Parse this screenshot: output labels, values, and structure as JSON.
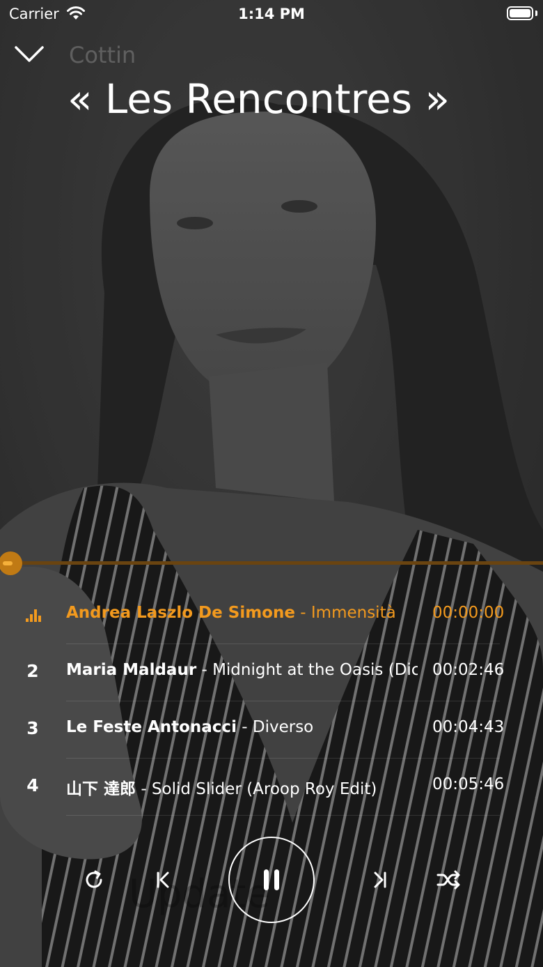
{
  "status_bar": {
    "carrier": "Carrier",
    "time": "1:14 PM"
  },
  "header": {
    "station": "Cottin",
    "show_title": "« Les Rencontres »",
    "close_icon": "chevron-down-icon"
  },
  "player": {
    "progress": 0.0,
    "accent_color": "#f39a1e"
  },
  "tracks": [
    {
      "number": "",
      "playing": true,
      "artist": "Andrea Laszlo De Simone",
      "title": " - Immensità",
      "time": "00:00:00"
    },
    {
      "number": "2",
      "playing": false,
      "artist": "Maria Maldaur",
      "title": " - Midnight at the Oasis (Dice Ed",
      "time": "00:02:46"
    },
    {
      "number": "3",
      "playing": false,
      "artist": "Le Feste Antonacci",
      "title": " - Diverso",
      "time": "00:04:43"
    },
    {
      "number": "4",
      "playing": false,
      "artist": "山下 達郎",
      "title": " - Solid Slider (Aroop Roy Edit)",
      "time": "00:05:46"
    }
  ],
  "background_text": "Update",
  "controls": {
    "repeat_icon": "repeat-icon",
    "previous_icon": "skip-previous-icon",
    "play_pause_icon": "pause-icon",
    "next_icon": "skip-next-icon",
    "shuffle_icon": "shuffle-icon"
  }
}
